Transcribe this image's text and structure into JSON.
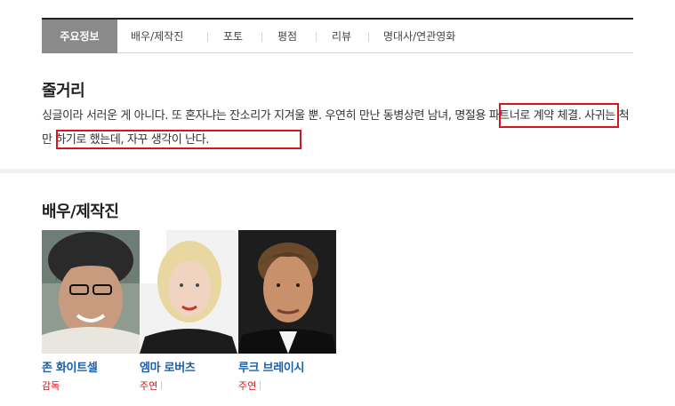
{
  "tabs": [
    {
      "label": "주요정보",
      "active": true
    },
    {
      "label": "배우/제작진",
      "active": false
    },
    {
      "label": "포토",
      "active": false
    },
    {
      "label": "평점",
      "active": false
    },
    {
      "label": "리뷰",
      "active": false
    },
    {
      "label": "명대사/연관영화",
      "active": false
    }
  ],
  "synopsis": {
    "title": "줄거리",
    "part1": "싱글이라 서러운 게 아니다. 또 혼자냐는 잔소리가 지겨울 뿐. 우연히 만난 동병상련 남녀, ",
    "highlight1": "명절용 파트너로 계약",
    "part2": " 체결. ",
    "highlight2": "사귀는 척만 하기로 했는데, 자꾸 생각이 난다.",
    "highlight_color": "#d9141c"
  },
  "cast_section": {
    "title": "배우/제작진",
    "people": [
      {
        "name": "존 화이트셀",
        "role": "감독"
      },
      {
        "name": "엠마 로버츠",
        "role": "주연"
      },
      {
        "name": "루크 브레이시",
        "role": "주연"
      }
    ]
  },
  "colors": {
    "name_link": "#1a5fa8",
    "role_text": "#d9141c",
    "active_tab_bg": "#8a8a8a"
  }
}
